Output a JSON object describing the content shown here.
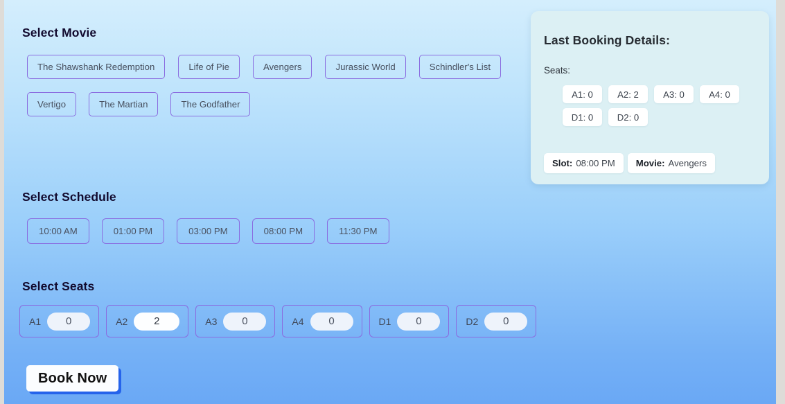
{
  "sections": {
    "movie_heading": "Select Movie",
    "schedule_heading": "Select Schedule",
    "seats_heading": "Select Seats"
  },
  "movies": [
    "The Shawshank Redemption",
    "Life of Pie",
    "Avengers",
    "Jurassic World",
    "Schindler's List",
    "Vertigo",
    "The Martian",
    "The Godfather"
  ],
  "schedules": [
    "10:00 AM",
    "01:00 PM",
    "03:00 PM",
    "08:00 PM",
    "11:30 PM"
  ],
  "seats": [
    {
      "label": "A1",
      "value": "0"
    },
    {
      "label": "A2",
      "value": "2"
    },
    {
      "label": "A3",
      "value": "0"
    },
    {
      "label": "A4",
      "value": "0"
    },
    {
      "label": "D1",
      "value": "0"
    },
    {
      "label": "D2",
      "value": "0"
    }
  ],
  "actions": {
    "book_now": "Book Now"
  },
  "last_booking": {
    "title": "Last Booking Details:",
    "seats_label": "Seats:",
    "seat_chips": [
      "A1: 0",
      "A2: 2",
      "A3: 0",
      "A4: 0",
      "D1: 0",
      "D2: 0"
    ],
    "slot_label": "Slot:",
    "slot_value": "08:00 PM",
    "movie_label": "Movie:",
    "movie_value": "Avengers"
  },
  "colors": {
    "accent_border": "#8a6ce0",
    "book_shadow": "#2563eb",
    "panel_bg": "#dcf0f4",
    "heading": "#120a2e"
  }
}
